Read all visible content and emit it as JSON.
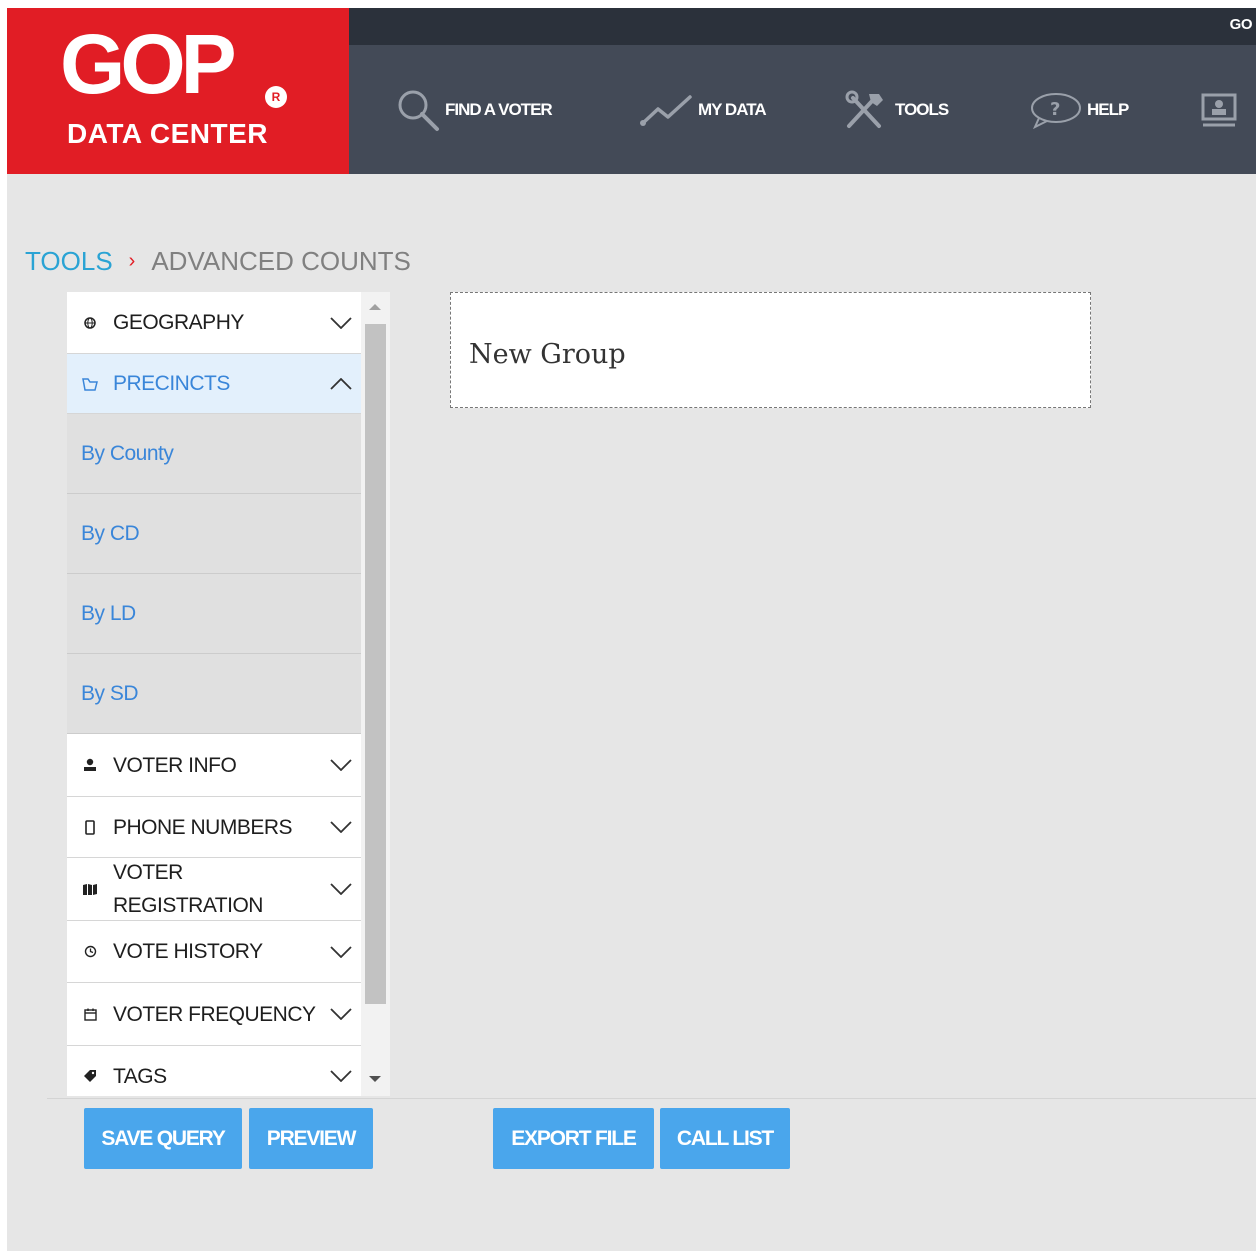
{
  "brand": {
    "name": "GOP",
    "registered": "R",
    "subtitle": "DATA CENTER"
  },
  "topbar": {
    "text": "GO"
  },
  "nav": [
    {
      "label": "FIND A VOTER",
      "icon": "search-icon"
    },
    {
      "label": "MY DATA",
      "icon": "chart-line-icon"
    },
    {
      "label": "TOOLS",
      "icon": "tools-icon"
    },
    {
      "label": "HELP",
      "icon": "help-bubble-icon"
    },
    {
      "label": "",
      "icon": "user-monitor-icon"
    }
  ],
  "breadcrumb": {
    "parent": "TOOLS",
    "separator": "›",
    "current": "ADVANCED COUNTS"
  },
  "sidebar": {
    "sections": [
      {
        "label": "GEOGRAPHY",
        "icon": "globe-icon",
        "expanded": false
      },
      {
        "label": "PRECINCTS",
        "icon": "precinct-icon",
        "expanded": true
      },
      {
        "label": "VOTER INFO",
        "icon": "person-icon",
        "expanded": false
      },
      {
        "label": "PHONE NUMBERS",
        "icon": "phone-icon",
        "expanded": false
      },
      {
        "label": "VOTER REGISTRATION",
        "line1": "VOTER",
        "line2": "REGISTRATION",
        "icon": "map-icon",
        "expanded": false
      },
      {
        "label": "VOTE HISTORY",
        "icon": "history-icon",
        "expanded": false
      },
      {
        "label": "VOTER FREQUENCY",
        "icon": "calendar-icon",
        "expanded": false
      },
      {
        "label": "TAGS",
        "icon": "tag-icon",
        "expanded": false
      }
    ],
    "precinct_items": [
      "By County",
      "By CD",
      "By LD",
      "By SD"
    ]
  },
  "group": {
    "title": "New Group"
  },
  "buttons": {
    "save_query": "SAVE QUERY",
    "preview": "PREVIEW",
    "export_file": "EXPORT FILE",
    "call_list": "CALL LIST"
  },
  "colors": {
    "brand_red": "#e11d25",
    "nav_bg": "#434a57",
    "topbar_bg": "#2b313b",
    "accent_blue": "#4aa6ec",
    "link_blue": "#3a86d9",
    "crumb_blue": "#2aa3d4"
  }
}
